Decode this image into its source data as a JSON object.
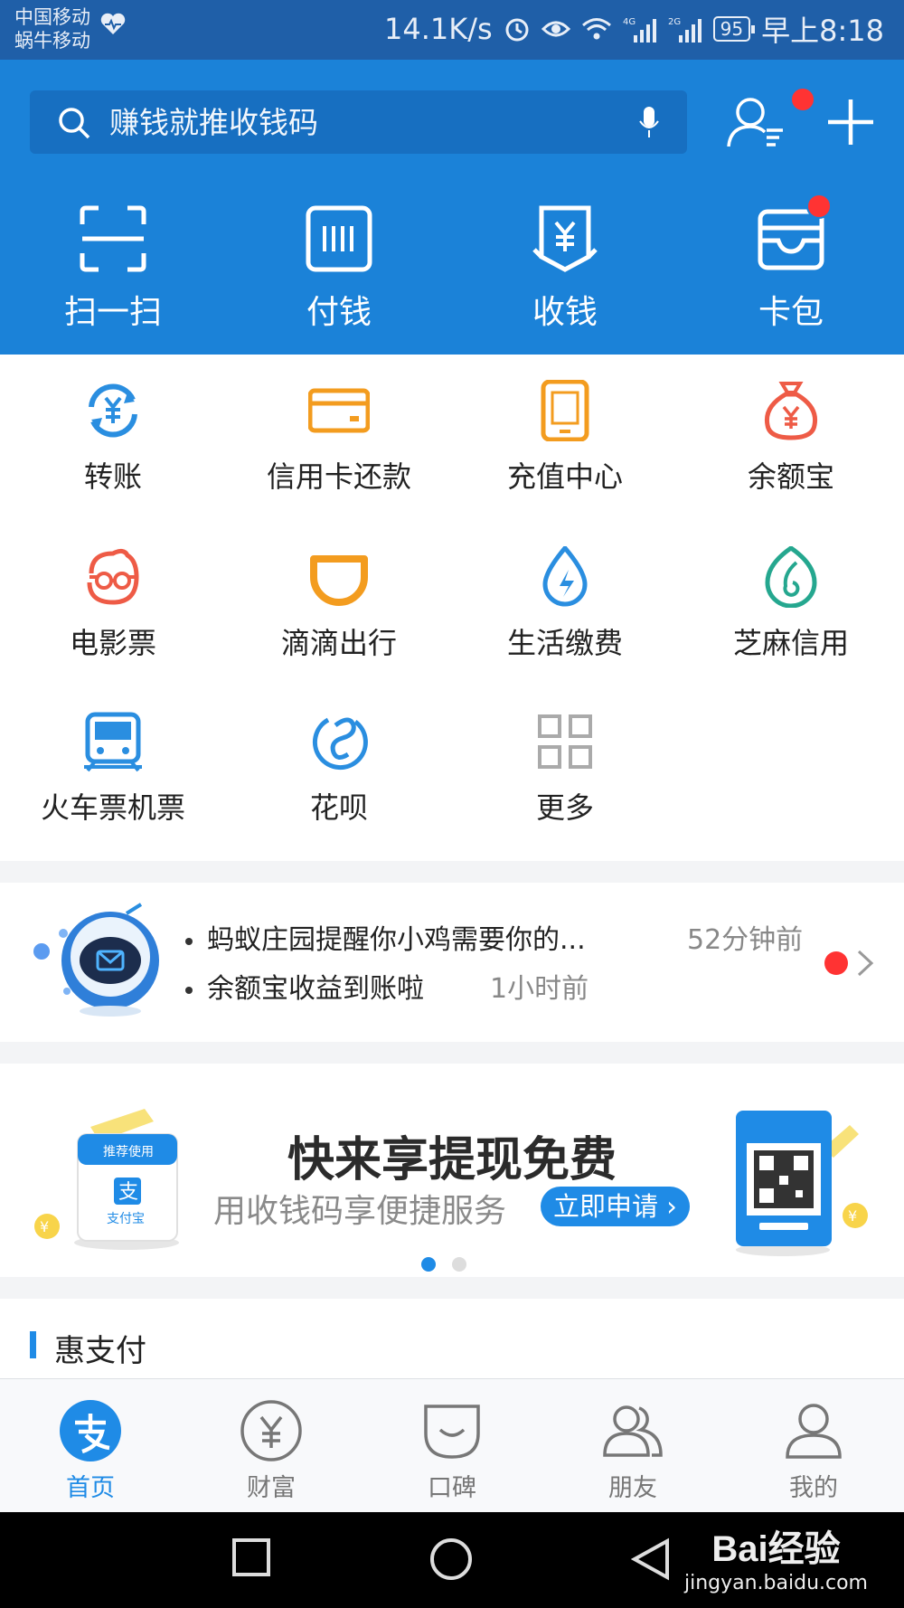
{
  "status_bar": {
    "carrier_1": "中国移动",
    "carrier_2": "蜗牛移动",
    "speed": "14.1K/s",
    "signal_1": "4G",
    "signal_2": "2G",
    "battery": "95",
    "time": "早上8:18"
  },
  "header": {
    "search_placeholder": "赚钱就推收钱码",
    "quick_actions": [
      {
        "label": "扫一扫",
        "icon": "scan-icon"
      },
      {
        "label": "付钱",
        "icon": "barcode-icon"
      },
      {
        "label": "收钱",
        "icon": "collect-money-icon"
      },
      {
        "label": "卡包",
        "icon": "card-wallet-icon"
      }
    ]
  },
  "apps": [
    {
      "label": "转账",
      "icon": "transfer-icon",
      "color": "#2a8ee0"
    },
    {
      "label": "信用卡还款",
      "icon": "credit-card-icon",
      "color": "#f39c1f"
    },
    {
      "label": "充值中心",
      "icon": "phone-recharge-icon",
      "color": "#f39c1f"
    },
    {
      "label": "余额宝",
      "icon": "money-bag-icon",
      "color": "#ee5b46"
    },
    {
      "label": "电影票",
      "icon": "movie-ticket-icon",
      "color": "#ee5b46"
    },
    {
      "label": "滴滴出行",
      "icon": "didi-icon",
      "color": "#f39c1f"
    },
    {
      "label": "生活缴费",
      "icon": "utility-drop-icon",
      "color": "#2a8ee0"
    },
    {
      "label": "芝麻信用",
      "icon": "sesame-credit-icon",
      "color": "#25a78f"
    },
    {
      "label": "火车票机票",
      "icon": "train-icon",
      "color": "#2a8ee0"
    },
    {
      "label": "花呗",
      "icon": "huabei-icon",
      "color": "#2a8ee0"
    },
    {
      "label": "更多",
      "icon": "more-grid-icon",
      "color": "#aaaaaa"
    }
  ],
  "notifications": [
    {
      "text": "蚂蚁庄园提醒你小鸡需要你的...",
      "time": "52分钟前"
    },
    {
      "text": "余额宝收益到账啦",
      "time": "1小时前"
    }
  ],
  "banner": {
    "title": "快来享提现免费",
    "subtitle": "用收钱码享便捷服务",
    "cta": "立即申请",
    "left_card_text": "推荐使用",
    "brand": "支付宝"
  },
  "section": {
    "title": "惠支付"
  },
  "tabs": [
    {
      "label": "首页",
      "icon": "alipay-home-icon",
      "active": true
    },
    {
      "label": "财富",
      "icon": "wealth-icon",
      "active": false
    },
    {
      "label": "口碑",
      "icon": "koubei-icon",
      "active": false
    },
    {
      "label": "朋友",
      "icon": "friends-icon",
      "active": false
    },
    {
      "label": "我的",
      "icon": "profile-icon",
      "active": false
    }
  ],
  "watermark": {
    "logo": "Bai经验",
    "url": "jingyan.baidu.com"
  },
  "colors": {
    "brand_blue": "#1b82d8",
    "accent_red": "#ff3333",
    "tab_active": "#1f8be6"
  }
}
